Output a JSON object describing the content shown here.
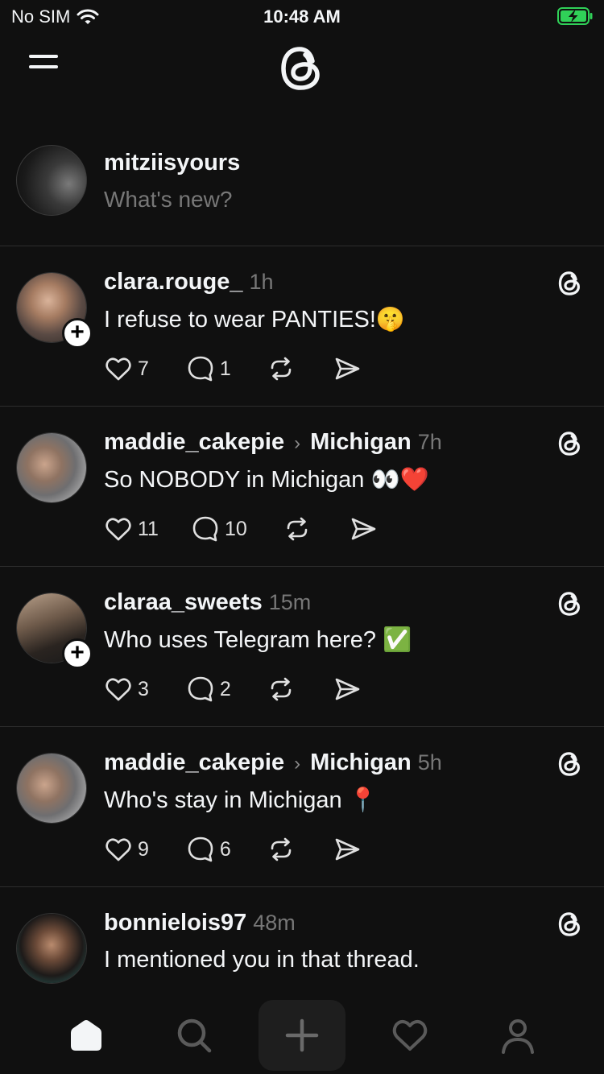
{
  "status": {
    "carrier": "No SIM",
    "time": "10:48 AM"
  },
  "composer": {
    "username": "mitziisyours",
    "prompt": "What's new?"
  },
  "posts": [
    {
      "username": "clara.rouge_",
      "community": "",
      "time": "1h",
      "text": "I refuse to wear PANTIES!🤫",
      "likes": "7",
      "replies": "1",
      "follow_badge": "+"
    },
    {
      "username": "maddie_cakepie",
      "community": "Michigan",
      "time": "7h",
      "text": "So NOBODY in Michigan 👀❤️",
      "likes": "11",
      "replies": "10",
      "follow_badge": ""
    },
    {
      "username": "claraa_sweets",
      "community": "",
      "time": "15m",
      "text": "Who uses Telegram here? ✅",
      "likes": "3",
      "replies": "2",
      "follow_badge": "+"
    },
    {
      "username": "maddie_cakepie",
      "community": "Michigan",
      "time": "5h",
      "text": "Who's stay in Michigan 📍",
      "likes": "9",
      "replies": "6",
      "follow_badge": ""
    },
    {
      "username": "bonnielois97",
      "community": "",
      "time": "48m",
      "text": "I mentioned you in that thread.",
      "likes": "",
      "replies": "",
      "follow_badge": ""
    }
  ],
  "chevron": "›",
  "tabs": [
    "home-icon",
    "search-icon",
    "new-post-icon",
    "activity-icon",
    "profile-icon"
  ],
  "colors": {
    "background": "#101010",
    "text": "#f3f5f7",
    "muted": "#777777",
    "divider": "#2d2d2d",
    "battery_green": "#30d158"
  }
}
